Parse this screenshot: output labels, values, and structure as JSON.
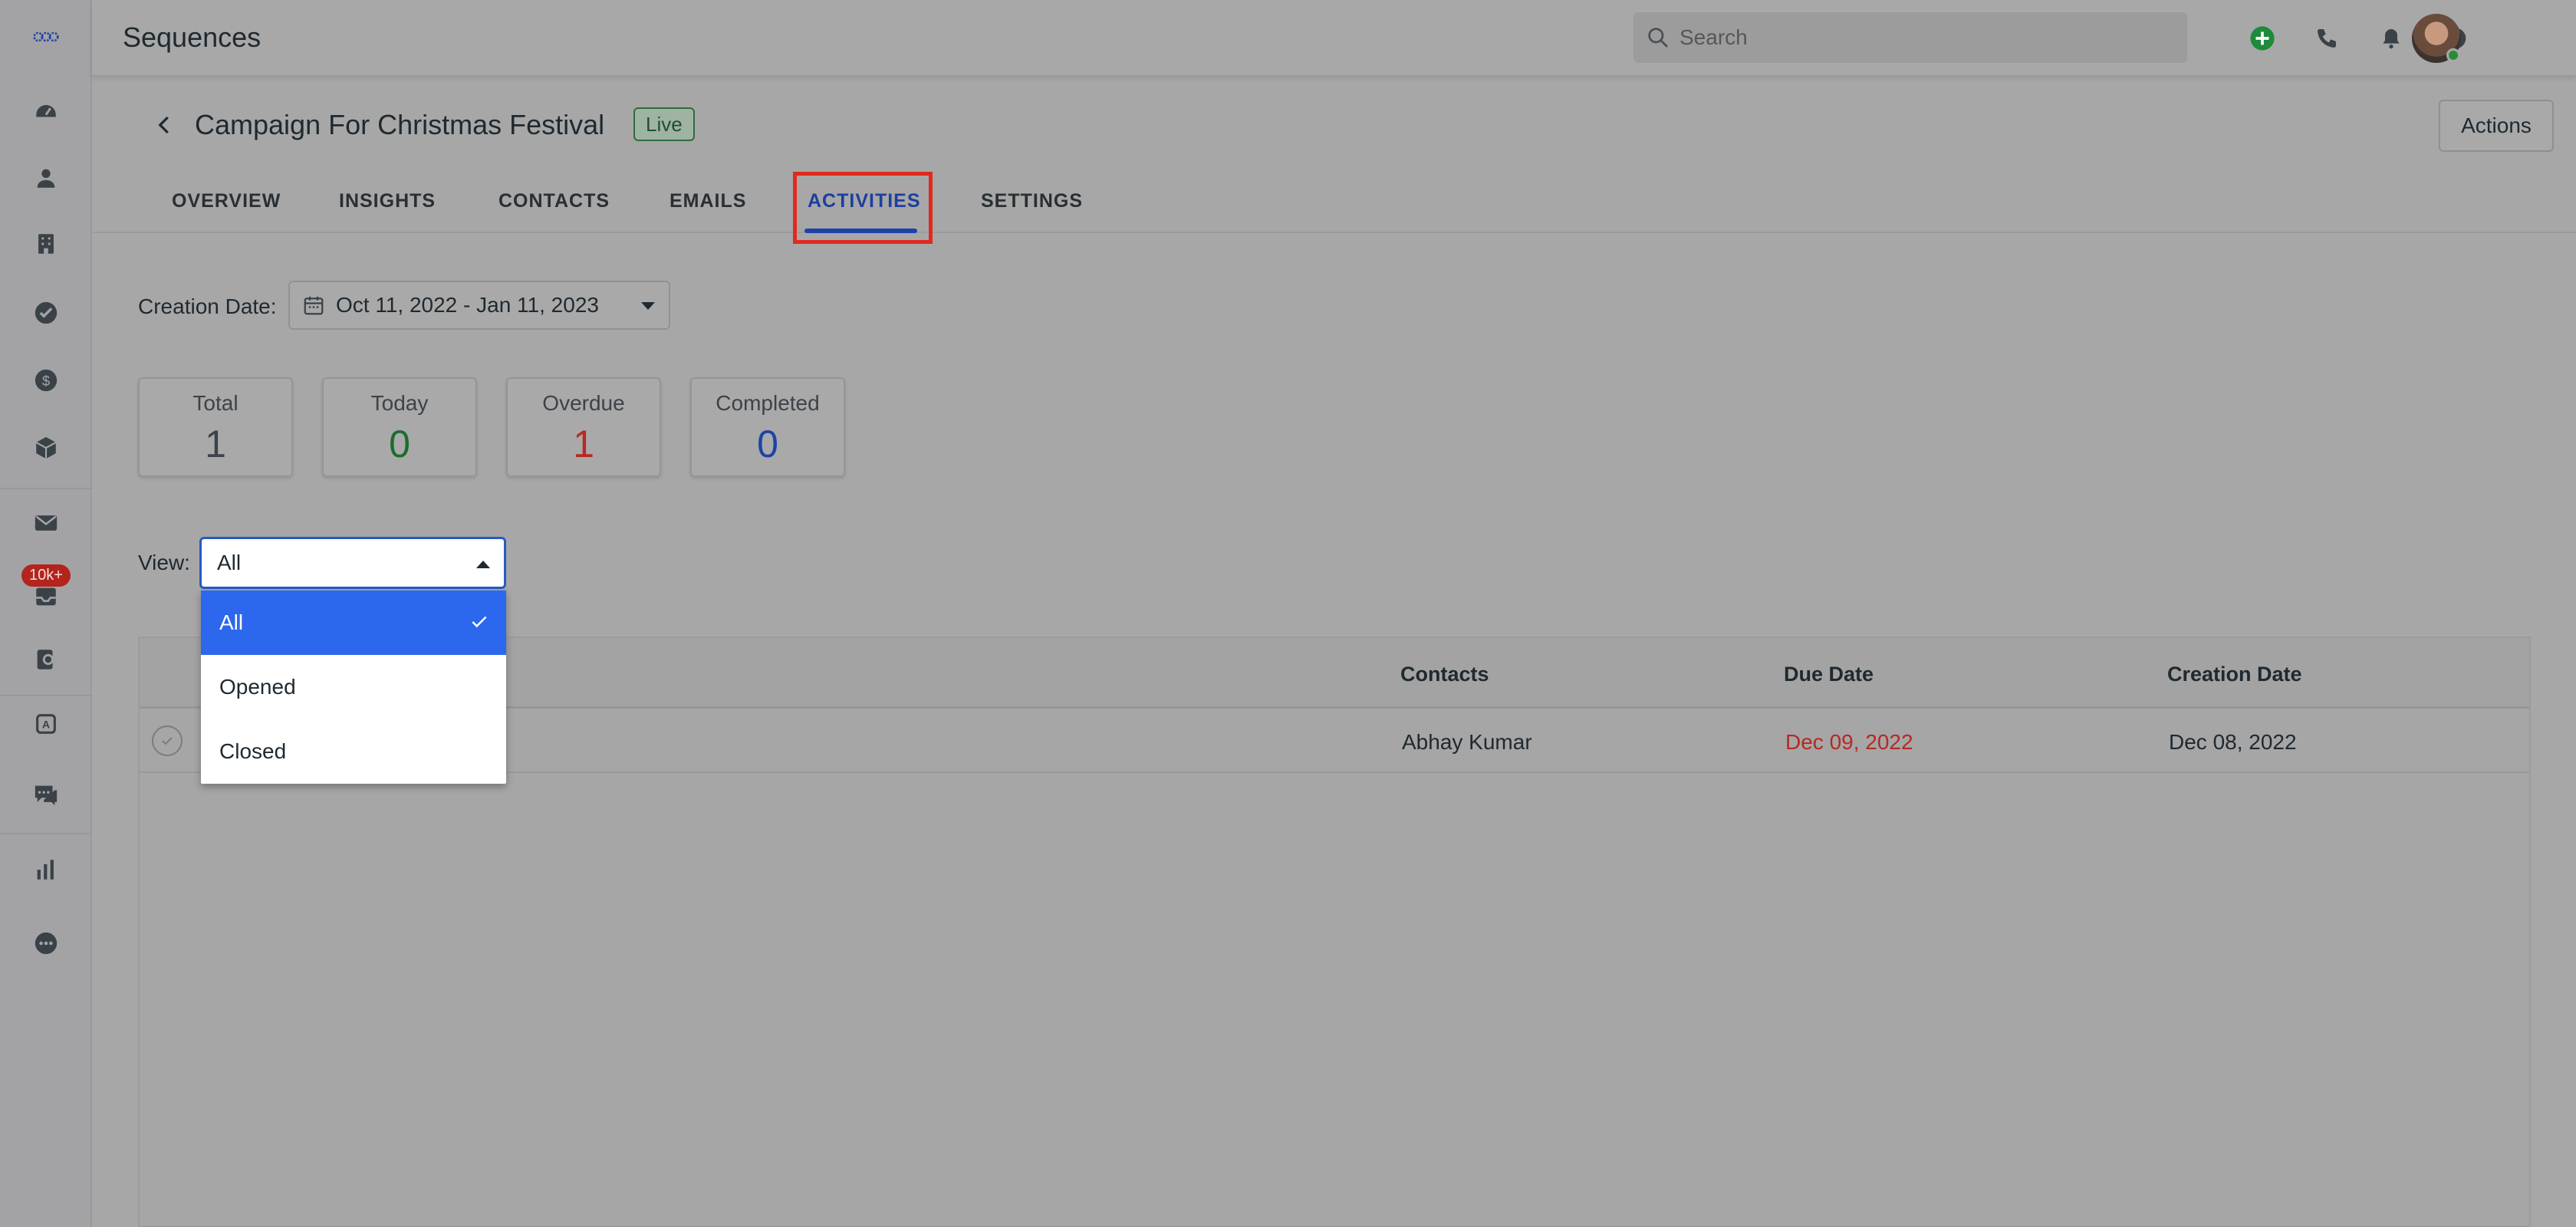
{
  "app": {
    "title": "Sequences"
  },
  "search": {
    "placeholder": "Search"
  },
  "header": {
    "title": "Campaign For Christmas Festival",
    "status": "Live",
    "actions_label": "Actions"
  },
  "tabs": [
    {
      "label": "OVERVIEW"
    },
    {
      "label": "INSIGHTS"
    },
    {
      "label": "CONTACTS"
    },
    {
      "label": "EMAILS"
    },
    {
      "label": "ACTIVITIES",
      "active": true
    },
    {
      "label": "SETTINGS"
    }
  ],
  "filter": {
    "label": "Creation Date:",
    "range": "Oct 11, 2022 - Jan 11, 2023"
  },
  "stats": [
    {
      "label": "Total",
      "value": "1",
      "color": "#3d4348"
    },
    {
      "label": "Today",
      "value": "0",
      "color": "#1e6b2c"
    },
    {
      "label": "Overdue",
      "value": "1",
      "color": "#b52a22"
    },
    {
      "label": "Completed",
      "value": "0",
      "color": "#1d43a8"
    }
  ],
  "view": {
    "label": "View:",
    "selected": "All",
    "options": [
      {
        "label": "All",
        "selected": true
      },
      {
        "label": "Opened"
      },
      {
        "label": "Closed"
      }
    ]
  },
  "table": {
    "headers": {
      "contacts": "Contacts",
      "due_date": "Due Date",
      "creation_date": "Creation Date"
    },
    "rows": [
      {
        "contact": "Abhay Kumar",
        "due_date": "Dec 09, 2022",
        "creation_date": "Dec 08, 2022"
      }
    ]
  },
  "sidebar": {
    "badge": "10k+"
  },
  "colors": {
    "accent": "#2b68ee",
    "overdue": "#b52a22",
    "live": "#214d2e"
  }
}
